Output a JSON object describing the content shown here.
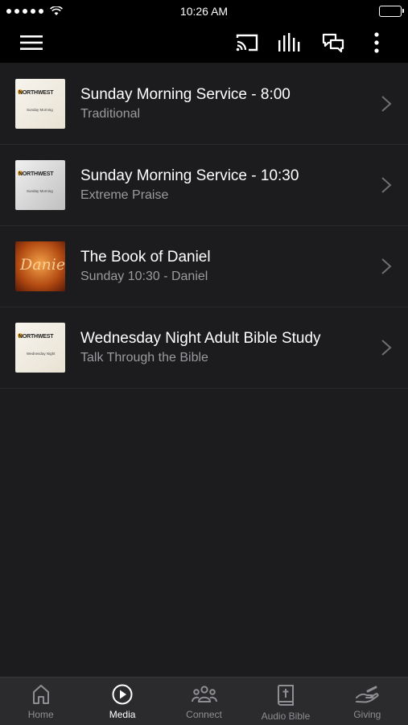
{
  "status_bar": {
    "time": "10:26 AM"
  },
  "nav_bar": {
    "icons": [
      "menu-icon",
      "cast-icon",
      "equalizer-icon",
      "chat-icon",
      "more-vertical-icon"
    ]
  },
  "media_list": [
    {
      "title": "Sunday Morning Service - 8:00",
      "subtitle": "Traditional",
      "thumb_brand": "NORTHWEST",
      "thumb_sub": "Sunday Morning"
    },
    {
      "title": "Sunday Morning Service - 10:30",
      "subtitle": "Extreme Praise",
      "thumb_brand": "NORTHWEST",
      "thumb_sub": "Sunday Morning"
    },
    {
      "title": "The Book of Daniel",
      "subtitle": "Sunday 10:30 - Daniel",
      "thumb_brand": "Daniel",
      "thumb_sub": ""
    },
    {
      "title": "Wednesday Night Adult Bible Study",
      "subtitle": "Talk Through the Bible",
      "thumb_brand": "NORTHWEST",
      "thumb_sub": "Wednesday Night"
    }
  ],
  "tab_bar": {
    "tabs": [
      {
        "label": "Home",
        "icon": "home-icon",
        "active": false
      },
      {
        "label": "Media",
        "icon": "play-circle-icon",
        "active": true
      },
      {
        "label": "Connect",
        "icon": "people-icon",
        "active": false
      },
      {
        "label": "Audio Bible",
        "icon": "bible-icon",
        "active": false
      },
      {
        "label": "Giving",
        "icon": "giving-hand-icon",
        "active": false
      }
    ]
  },
  "colors": {
    "background": "#1c1c1e",
    "bar": "#000000",
    "tabbar": "#2b2b2d",
    "subtitle": "#9b9b9f",
    "inactive": "#8e8e93"
  }
}
